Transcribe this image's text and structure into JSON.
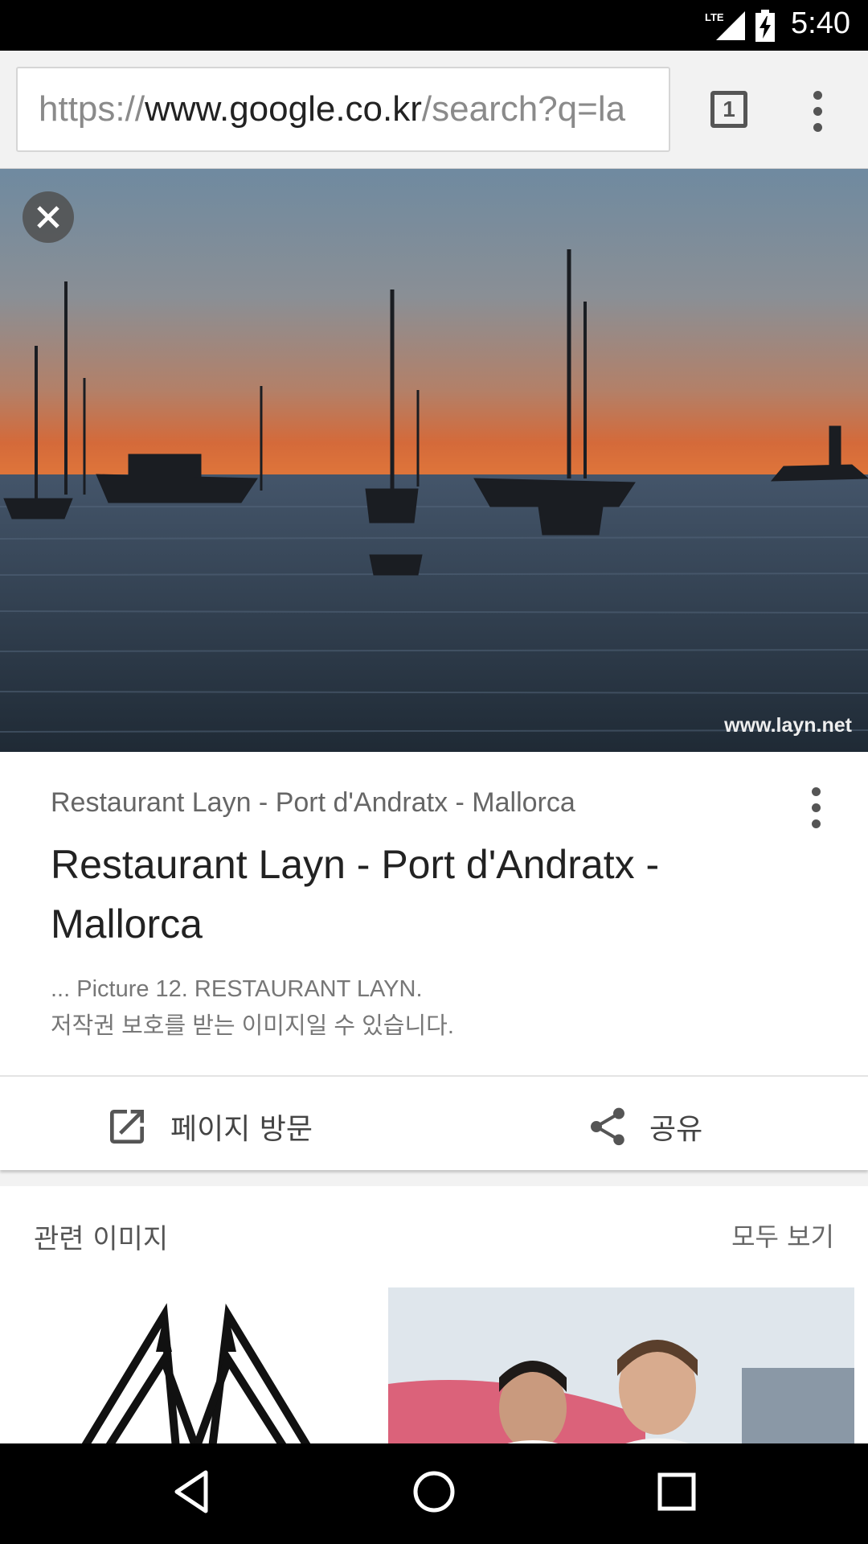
{
  "status_bar": {
    "network": "LTE",
    "time": "5:40"
  },
  "browser": {
    "url_scheme": "https://",
    "url_host": "www.google.co.kr",
    "url_path": "/search?q=la",
    "tab_count": "1"
  },
  "image_viewer": {
    "watermark": "www.layn.net",
    "source_site": "Restaurant Layn - Port d'Andratx - Mallorca",
    "title": "Restaurant Layn - Port d'Andratx - Mallorca",
    "snippet": "... Picture 12. RESTAURANT LAYN.",
    "copyright_note": "저작권 보호를 받는 이미지일 수 있습니다.",
    "visit_label": "페이지 방문",
    "share_label": "공유"
  },
  "related": {
    "title": "관련 이미지",
    "view_all": "모두 보기"
  },
  "colors": {
    "status_bar": "#000000",
    "toolbar": "#f2f2f2",
    "sky_top": "#6f8aa0",
    "sky_sunset": "#e0763a",
    "sea": "#2c3a4a"
  }
}
